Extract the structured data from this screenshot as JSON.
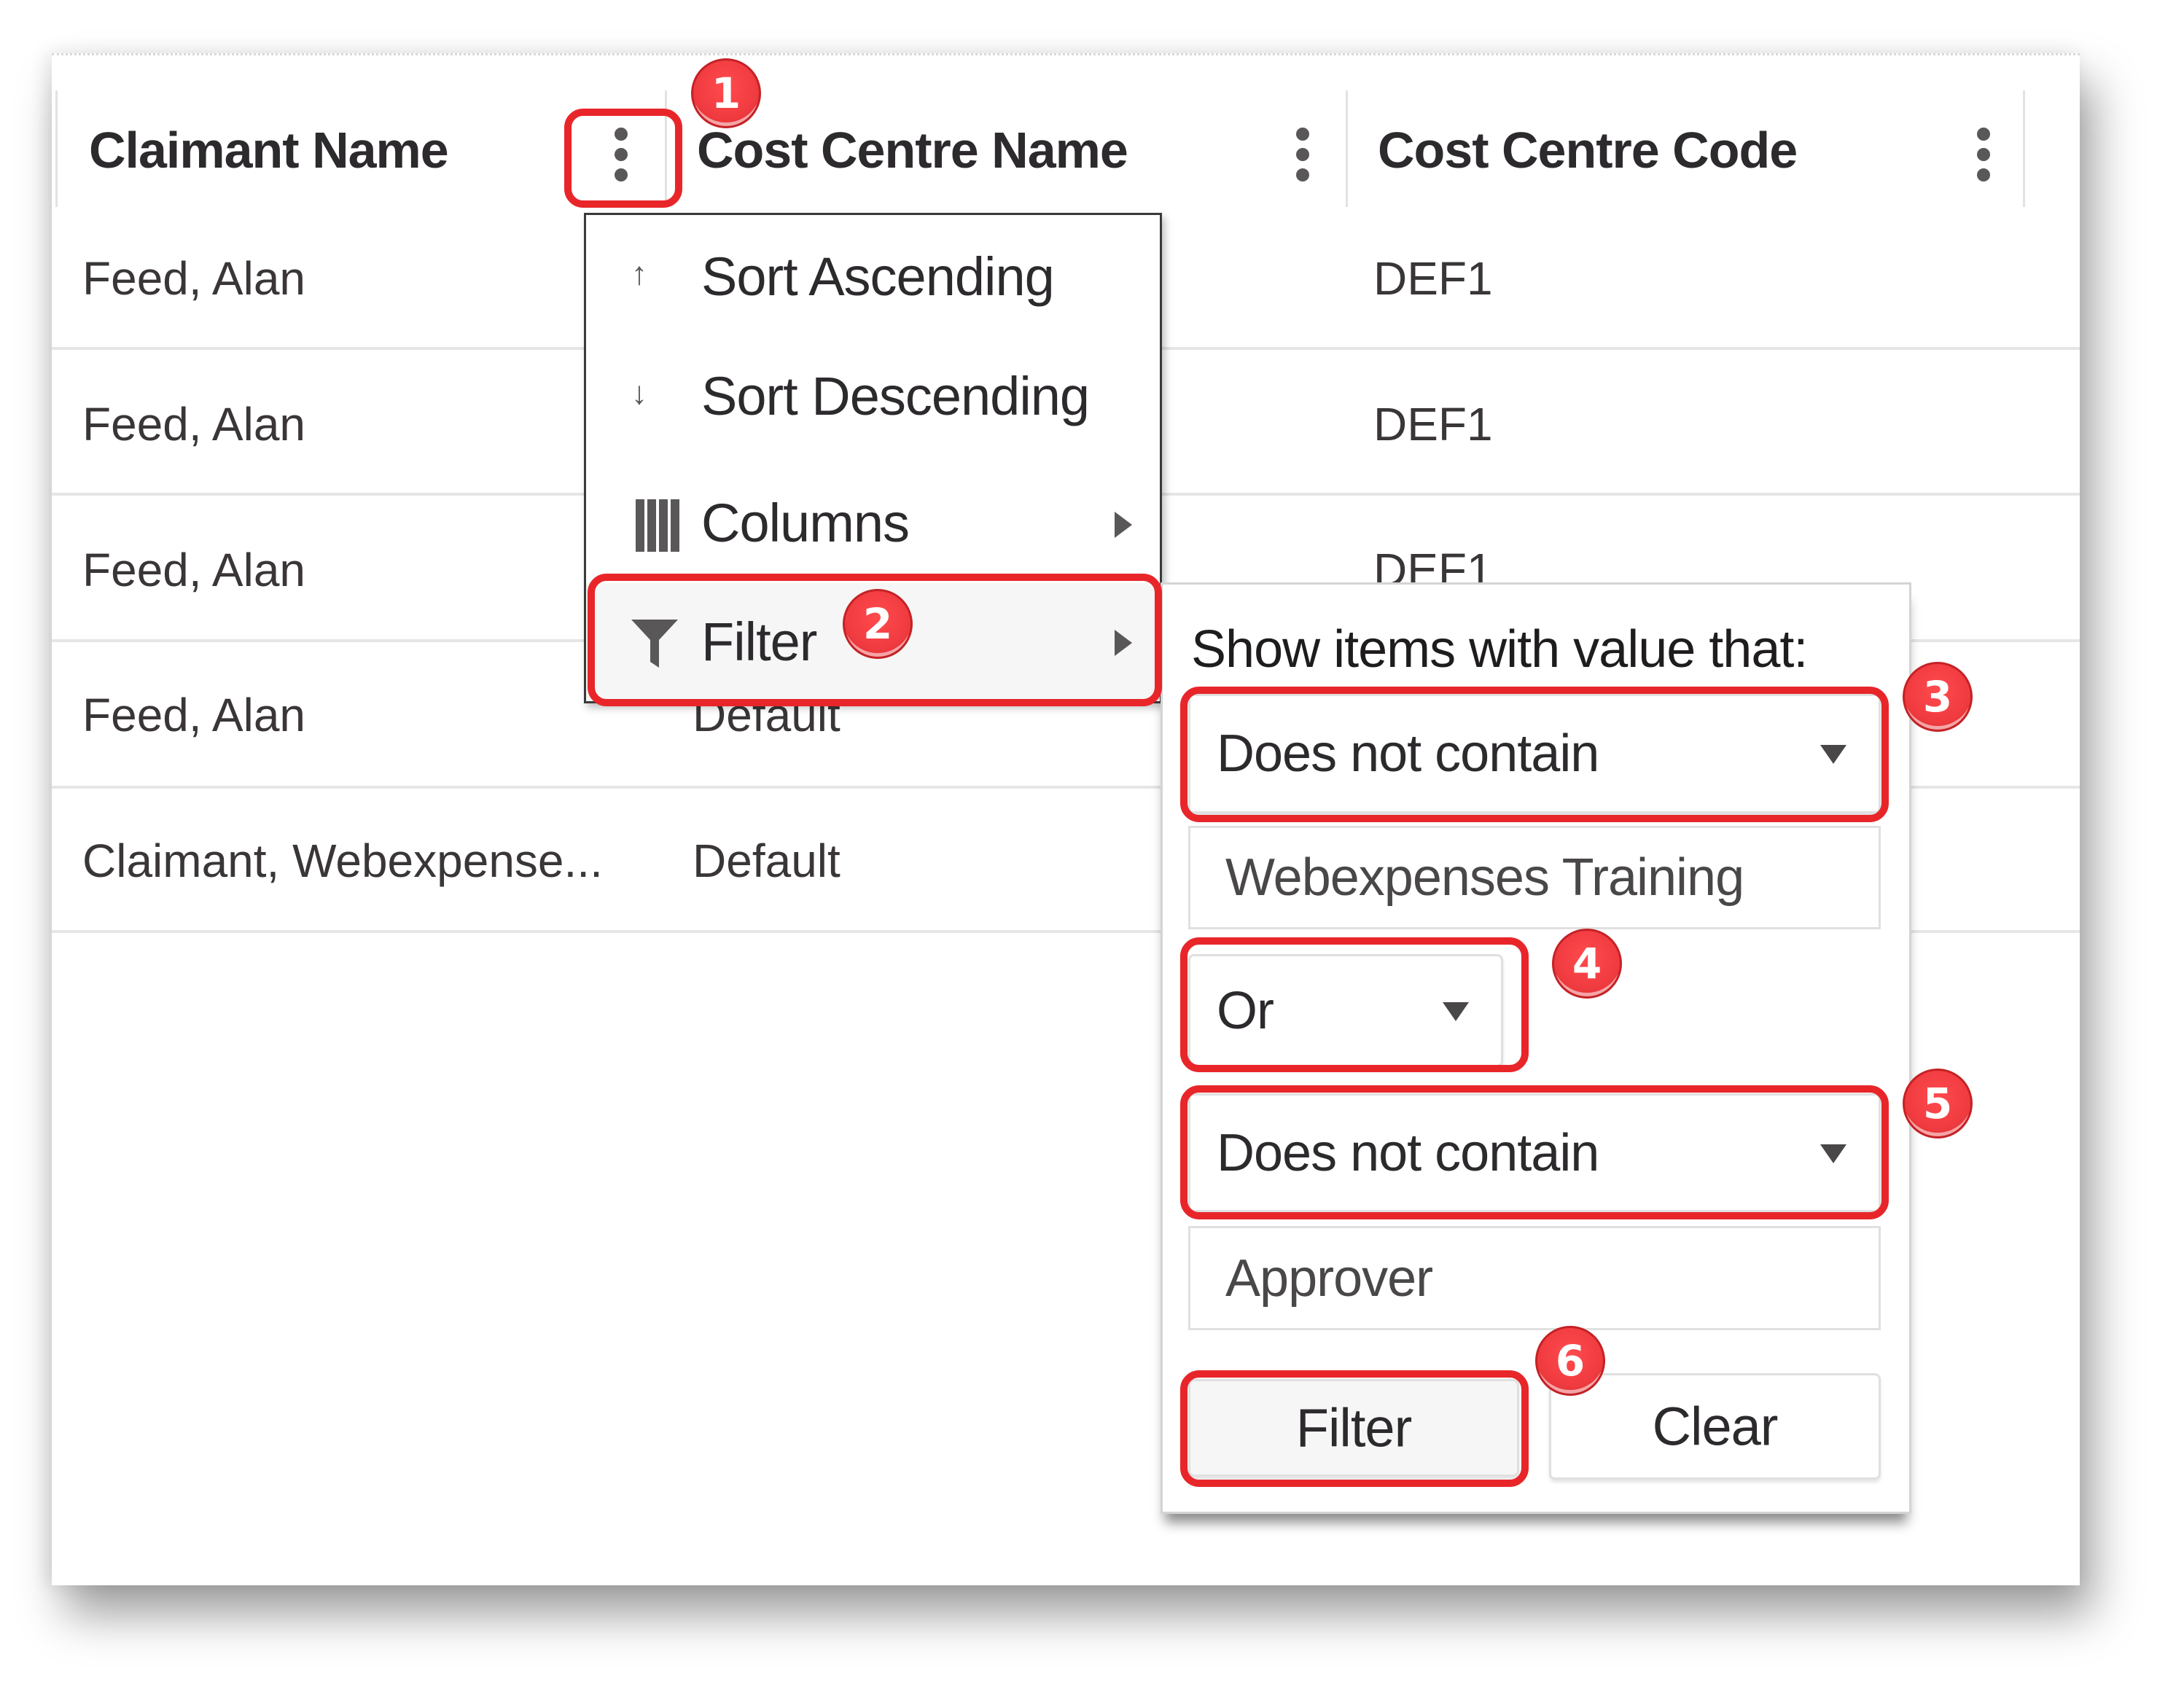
{
  "table": {
    "columns": [
      {
        "label": "Claimant Name"
      },
      {
        "label": "Cost Centre Name"
      },
      {
        "label": "Cost Centre Code"
      }
    ],
    "rows": [
      {
        "claimant": "Feed, Alan",
        "cc_name": "",
        "cc_code": "DEF1"
      },
      {
        "claimant": "Feed, Alan",
        "cc_name": "",
        "cc_code": "DEF1"
      },
      {
        "claimant": "Feed, Alan",
        "cc_name": "",
        "cc_code": "DEF1"
      },
      {
        "claimant": "Feed, Alan",
        "cc_name": "Default",
        "cc_code": ""
      },
      {
        "claimant": "Claimant, Webexpense...",
        "cc_name": "Default",
        "cc_code": ""
      }
    ]
  },
  "column_menu": {
    "items": [
      {
        "label": "Sort Ascending",
        "icon": "arrow-up-icon",
        "glyph": "↑"
      },
      {
        "label": "Sort Descending",
        "icon": "arrow-down-icon",
        "glyph": "↓"
      },
      {
        "label": "Columns",
        "icon": "columns-icon",
        "has_submenu": true
      },
      {
        "label": "Filter",
        "icon": "filter-icon",
        "has_submenu": true,
        "active": true
      }
    ]
  },
  "filter_panel": {
    "title": "Show items with value that:",
    "operator1": "Does not contain",
    "value1": "Webexpenses Training",
    "logic": "Or",
    "operator2": "Does not contain",
    "value2": "Approver",
    "filter_button": "Filter",
    "clear_button": "Clear"
  },
  "annotations": {
    "badges": [
      "1",
      "2",
      "3",
      "4",
      "5",
      "6"
    ],
    "color": "#e8262a"
  }
}
